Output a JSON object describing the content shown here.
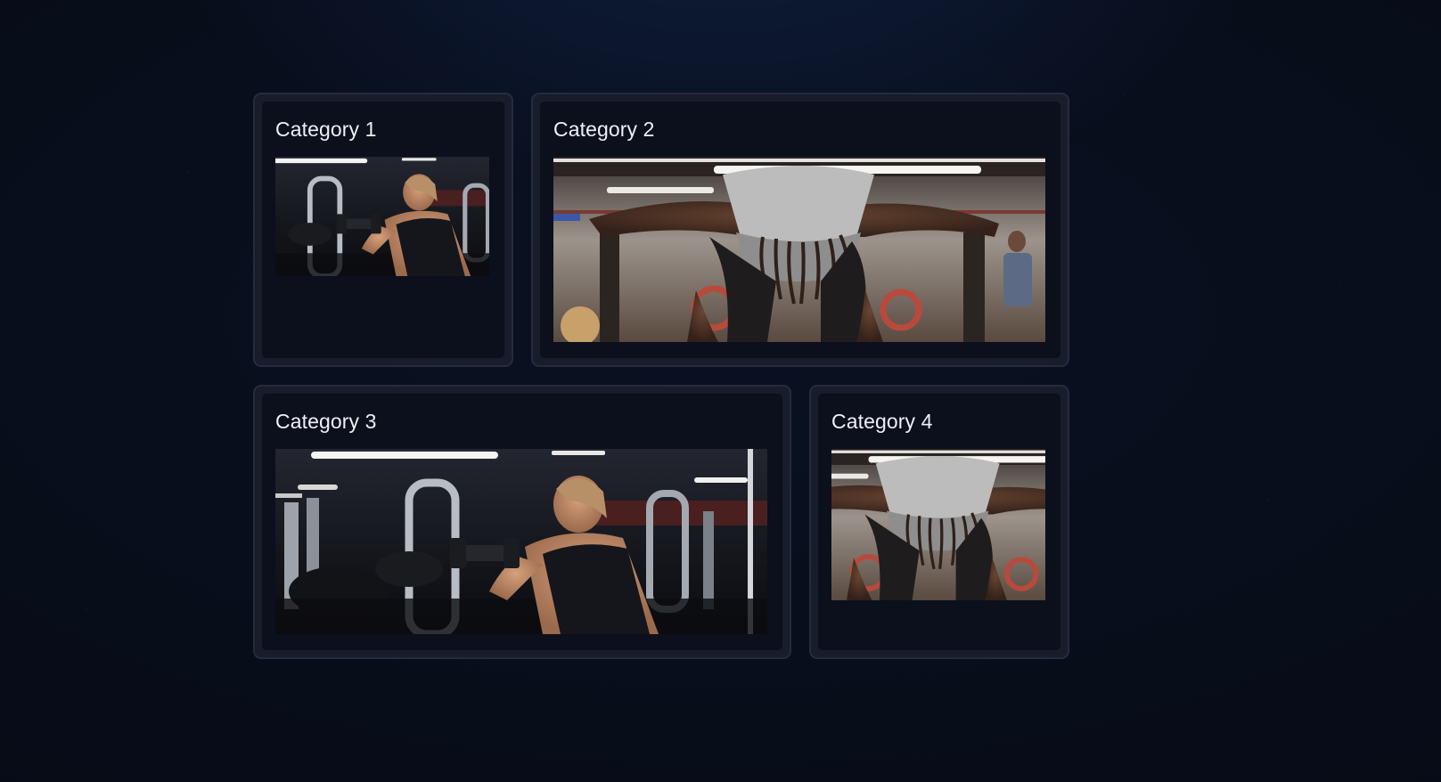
{
  "categories": [
    {
      "title": "Category 1",
      "image": "woman-dumbbell-gym-photo"
    },
    {
      "title": "Category 2",
      "image": "man-leaning-bars-gym-photo"
    },
    {
      "title": "Category 3",
      "image": "woman-dumbbell-gym-photo"
    },
    {
      "title": "Category 4",
      "image": "man-leaning-bars-gym-photo"
    }
  ]
}
